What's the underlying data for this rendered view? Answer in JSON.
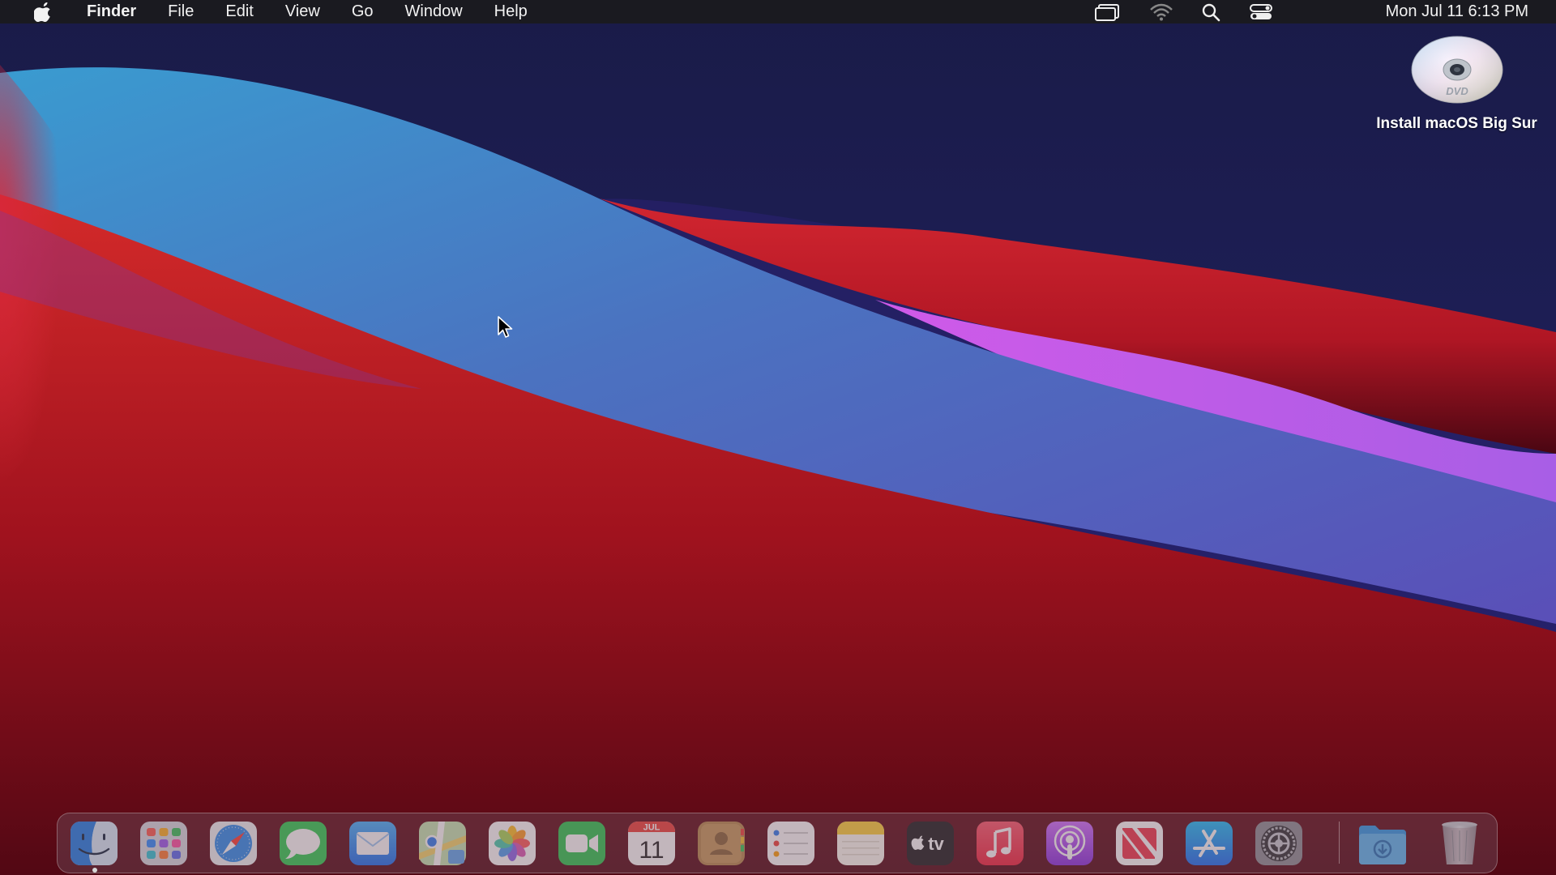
{
  "menubar": {
    "apple_menu": "apple-icon",
    "items": [
      {
        "label": "Finder",
        "bold": true
      },
      {
        "label": "File"
      },
      {
        "label": "Edit"
      },
      {
        "label": "View"
      },
      {
        "label": "Go"
      },
      {
        "label": "Window"
      },
      {
        "label": "Help"
      }
    ],
    "status_icons": [
      "screen-mirroring-icon",
      "wifi-icon",
      "spotlight-search-icon",
      "control-center-icon"
    ],
    "clock": "Mon Jul 11  6:13 PM"
  },
  "desktop": {
    "icons": [
      {
        "label": "Install macOS Big Sur",
        "icon": "dvd-disc-icon",
        "disc_text": "DVD"
      }
    ]
  },
  "dock": {
    "apps": [
      {
        "name": "finder",
        "icon": "finder-icon",
        "running": true
      },
      {
        "name": "launchpad",
        "icon": "launchpad-icon"
      },
      {
        "name": "safari",
        "icon": "safari-icon"
      },
      {
        "name": "messages",
        "icon": "messages-icon"
      },
      {
        "name": "mail",
        "icon": "mail-icon"
      },
      {
        "name": "maps",
        "icon": "maps-icon"
      },
      {
        "name": "photos",
        "icon": "photos-icon"
      },
      {
        "name": "facetime",
        "icon": "facetime-icon"
      },
      {
        "name": "calendar",
        "icon": "calendar-icon",
        "month": "JUL",
        "day": "11"
      },
      {
        "name": "contacts",
        "icon": "contacts-icon"
      },
      {
        "name": "reminders",
        "icon": "reminders-icon"
      },
      {
        "name": "notes",
        "icon": "notes-icon"
      },
      {
        "name": "apple-tv",
        "icon": "apple-tv-icon",
        "text": "tv"
      },
      {
        "name": "music",
        "icon": "music-icon"
      },
      {
        "name": "podcasts",
        "icon": "podcasts-icon"
      },
      {
        "name": "news",
        "icon": "news-icon"
      },
      {
        "name": "app-store",
        "icon": "app-store-icon"
      },
      {
        "name": "system-preferences",
        "icon": "system-preferences-icon"
      }
    ],
    "others": [
      {
        "name": "downloads",
        "icon": "downloads-folder-icon"
      },
      {
        "name": "trash",
        "icon": "trash-icon"
      }
    ]
  },
  "colors": {
    "menubar_bg": "#1a1a1e",
    "wallpaper_navy": "#1b1c4a",
    "wallpaper_blue": "#3a8fc8",
    "wallpaper_red": "#d8262e",
    "wallpaper_purple": "#b05ae0",
    "wallpaper_maroon": "#5a0a16"
  }
}
